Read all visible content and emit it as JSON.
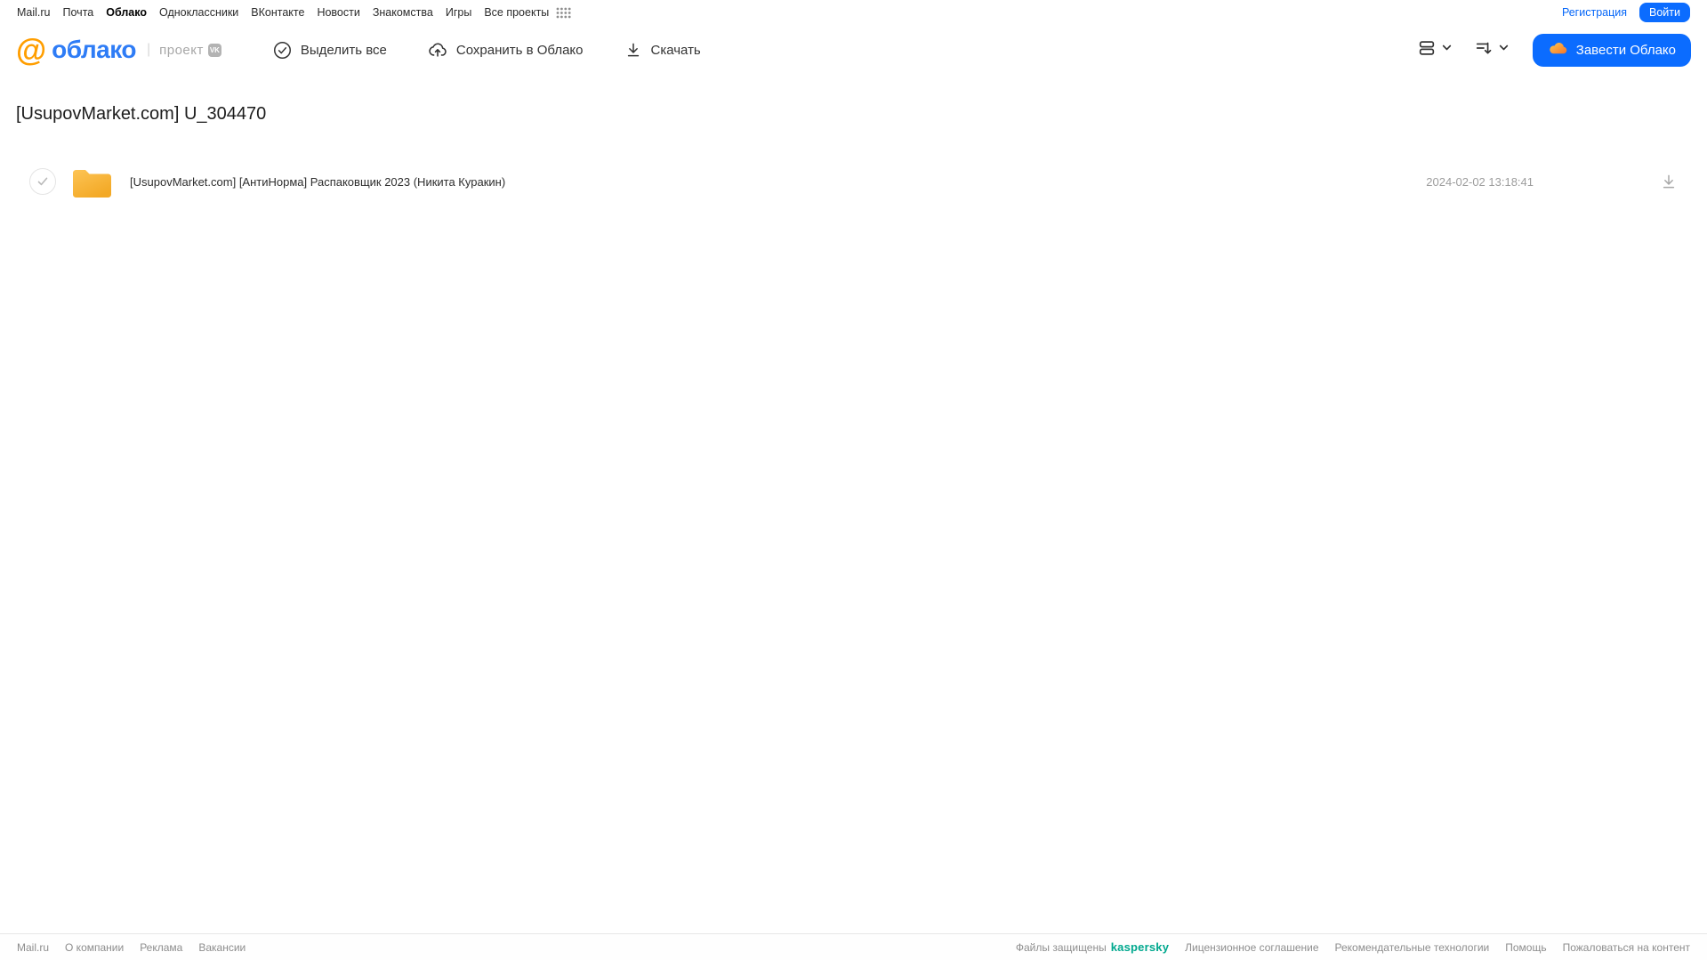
{
  "topnav": {
    "items": [
      "Mail.ru",
      "Почта",
      "Облако",
      "Одноклассники",
      "ВКонтакте",
      "Новости",
      "Знакомства",
      "Игры",
      "Все проекты"
    ],
    "registration": "Регистрация",
    "login": "Войти"
  },
  "header": {
    "logo_text": "облако",
    "project_label": "проект",
    "vk_badge": "VK",
    "select_all": "Выделить все",
    "save_to_cloud": "Сохранить в Облако",
    "download": "Скачать",
    "create_cloud": "Завести Облако"
  },
  "content": {
    "title": "[UsupovMarket.com] U_304470",
    "file": {
      "name": "[UsupovMarket.com] [АнтиНорма] Распаковщик 2023 (Никита Куракин)",
      "date": "2024-02-02 13:18:41"
    }
  },
  "footer": {
    "links_left": [
      "Mail.ru",
      "О компании",
      "Реклама",
      "Вакансии"
    ],
    "protected_label": "Файлы защищены",
    "kaspersky": "kaspersky",
    "links_right": [
      "Лицензионное соглашение",
      "Рекомендательные технологии",
      "Помощь",
      "Пожаловаться на контент"
    ]
  },
  "colors": {
    "accent_blue": "#0b6cff",
    "logo_orange": "#ff9e00",
    "folder_yellow": "#f7b224",
    "kaspersky_green": "#00a88e",
    "text_gray": "#9d9d9d"
  }
}
